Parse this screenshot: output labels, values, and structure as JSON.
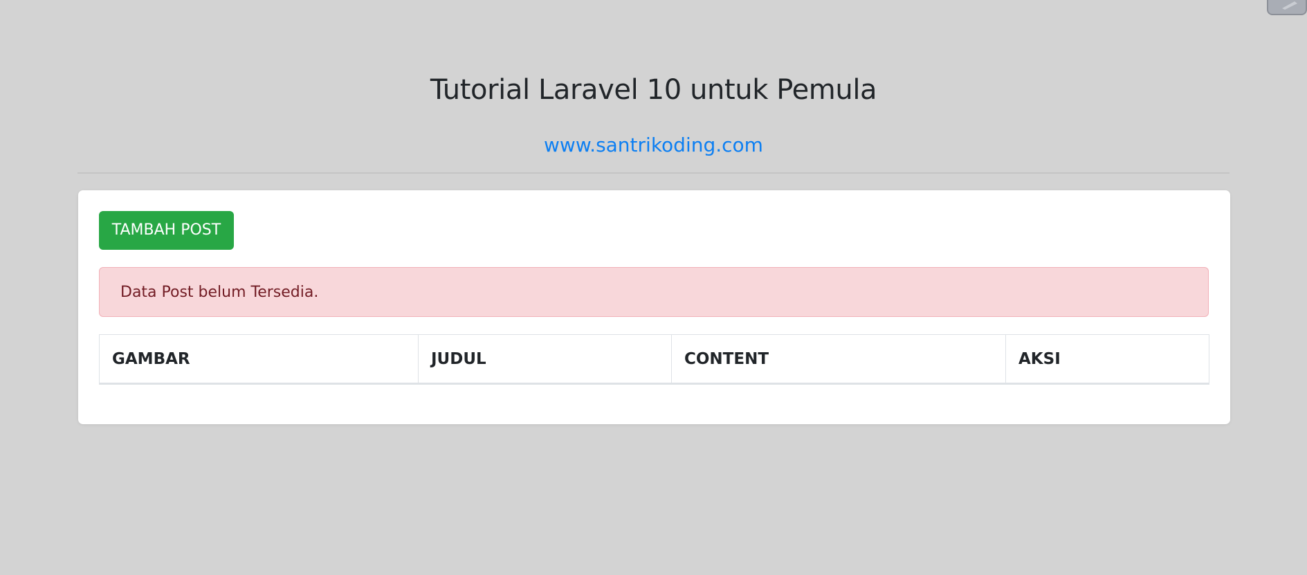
{
  "header": {
    "title": "Tutorial Laravel 10 untuk Pemula",
    "site_link": "www.santrikoding.com"
  },
  "card": {
    "add_button_label": "TAMBAH POST",
    "alert_message": "Data Post belum Tersedia.",
    "table": {
      "columns": [
        "GAMBAR",
        "JUDUL",
        "CONTENT",
        "AKSI"
      ],
      "rows": []
    }
  },
  "colors": {
    "background": "#d3d3d3",
    "link": "#0d7ff2",
    "button": "#28a745",
    "alert_background": "#f8d7da",
    "alert_text": "#721c24"
  },
  "icons": {
    "corner_widget": "pencil-icon"
  }
}
